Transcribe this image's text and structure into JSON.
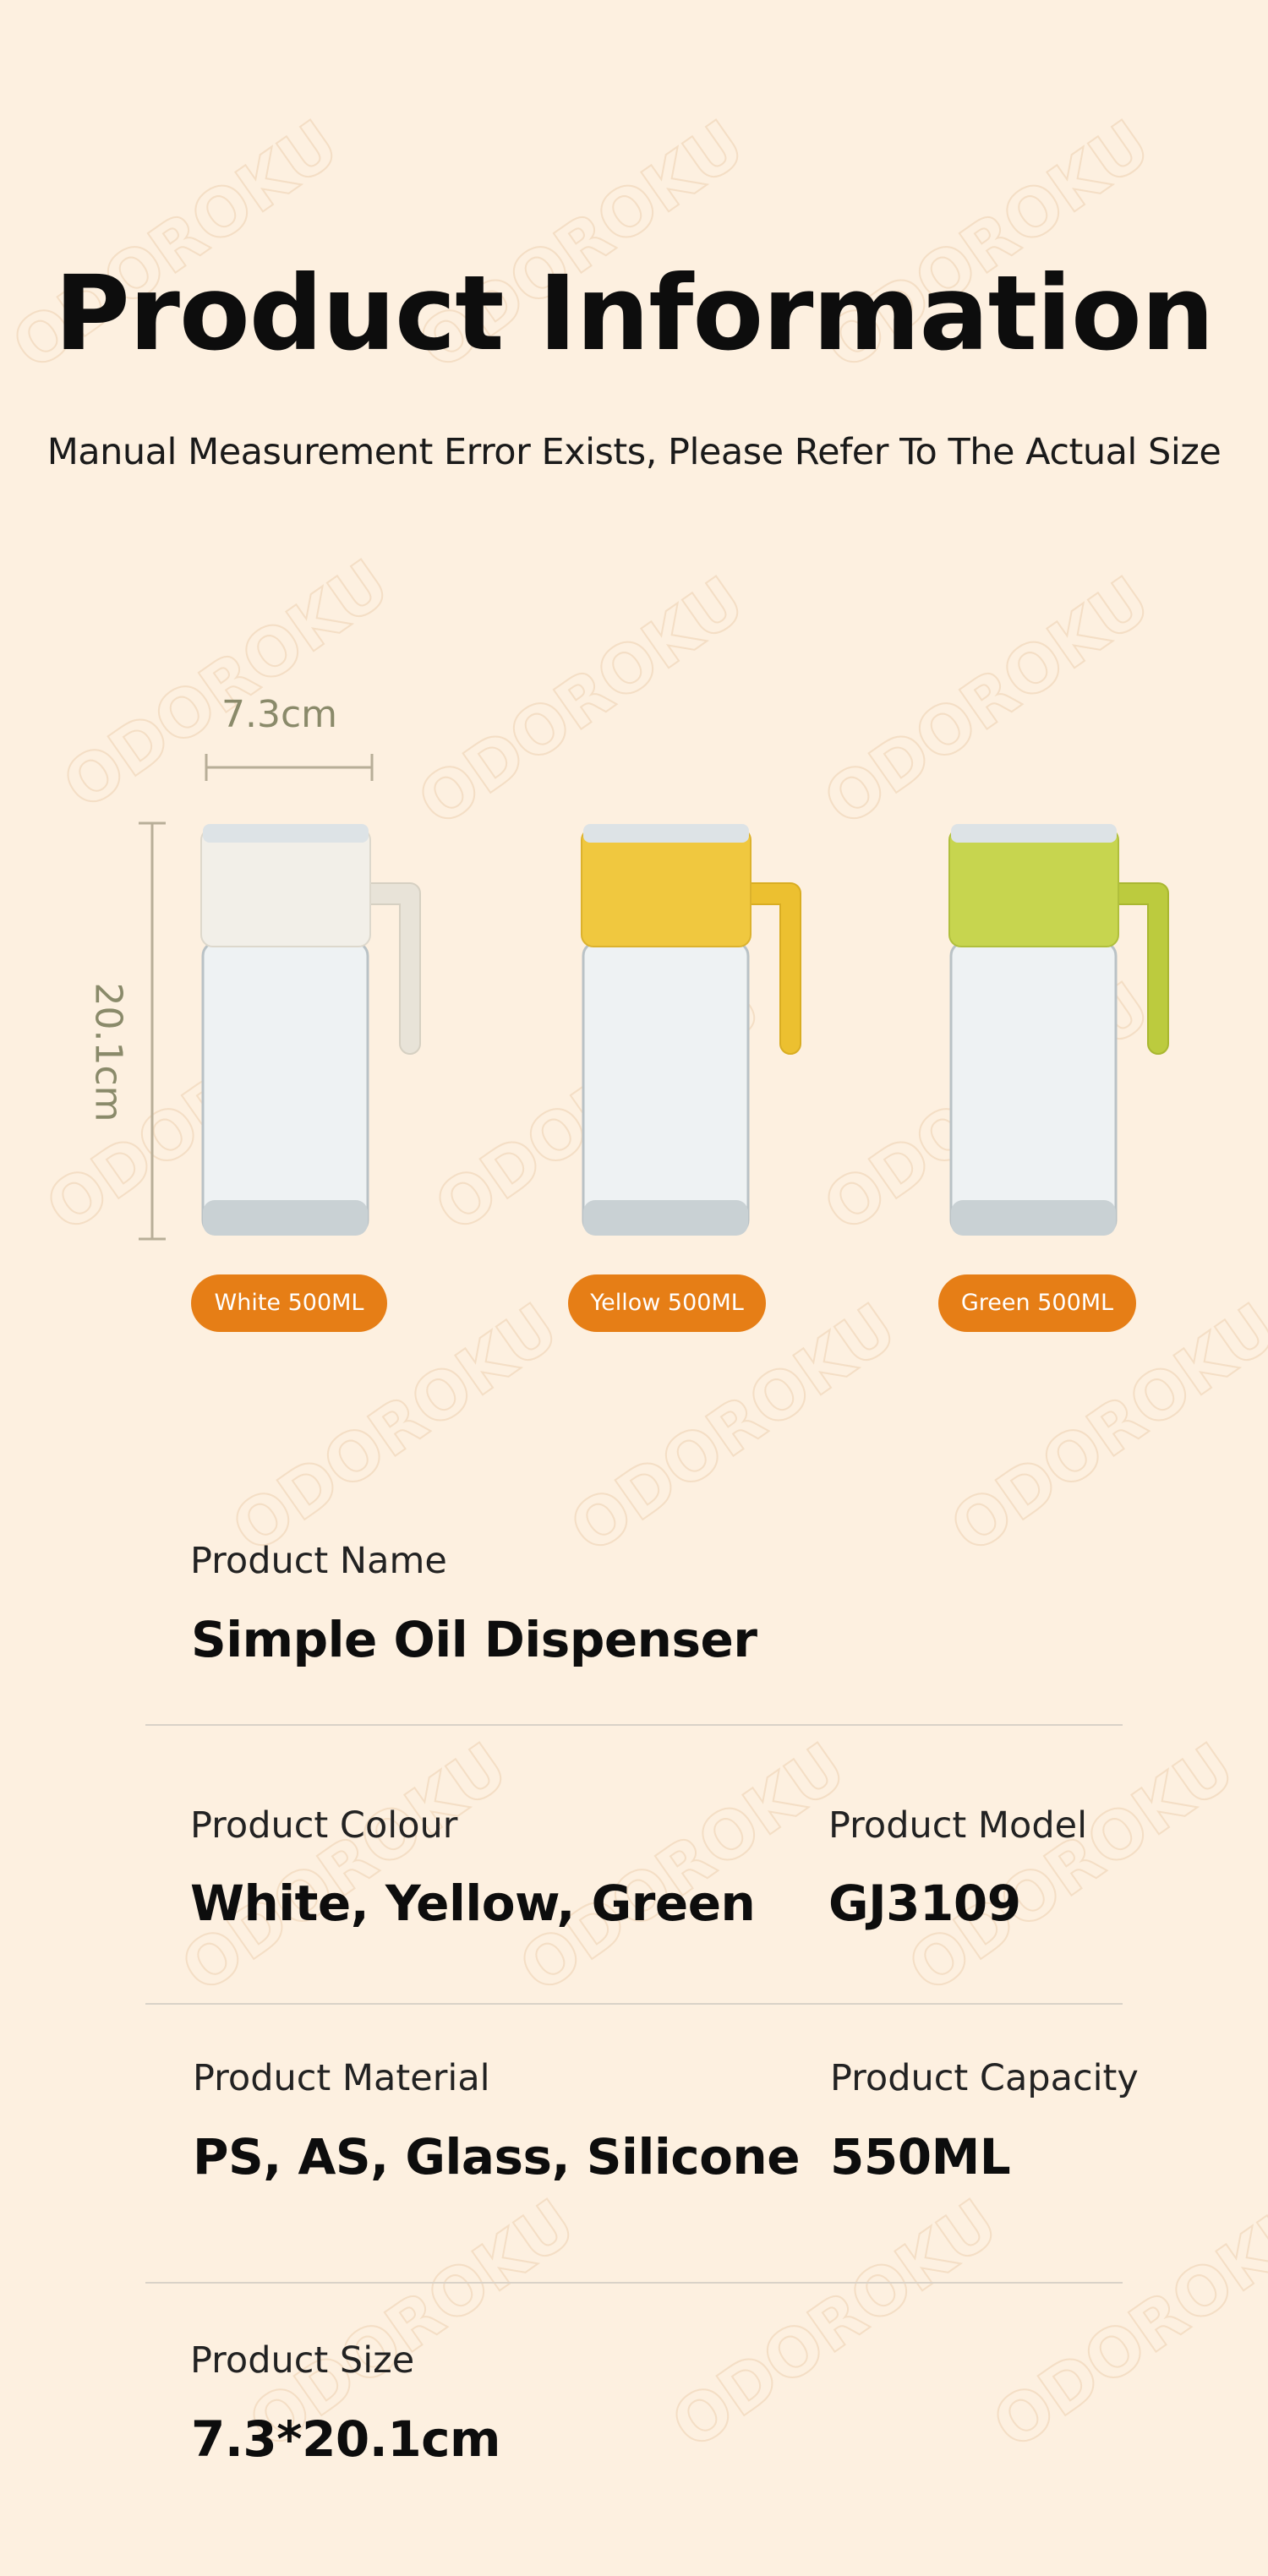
{
  "header": {
    "title": "Product Information",
    "subtitle": "Manual Measurement Error Exists, Please Refer To The Actual Size"
  },
  "watermark": "ODOROKU",
  "dimensions": {
    "width_label": "7.3cm",
    "height_label": "20.1cm"
  },
  "variants": [
    {
      "label": "White 500ML",
      "color": "#f2efe8",
      "handle": "#ece7dc"
    },
    {
      "label": "Yellow 500ML",
      "color": "#f0c83f",
      "handle": "#ecc030"
    },
    {
      "label": "Green 500ML",
      "color": "#c7d54f",
      "handle": "#bccb3e"
    }
  ],
  "badge_color": "#e67e16",
  "specs": {
    "name": {
      "label": "Product Name",
      "value": "Simple Oil Dispenser"
    },
    "colour": {
      "label": "Product Colour",
      "value": "White, Yellow, Green"
    },
    "model": {
      "label": "Product Model",
      "value": "GJ3109"
    },
    "material": {
      "label": "Product Material",
      "value": "PS, AS, Glass, Silicone"
    },
    "capacity": {
      "label": "Product Capacity",
      "value": "550ML"
    },
    "size": {
      "label": "Product Size",
      "value": "7.3*20.1cm"
    }
  }
}
